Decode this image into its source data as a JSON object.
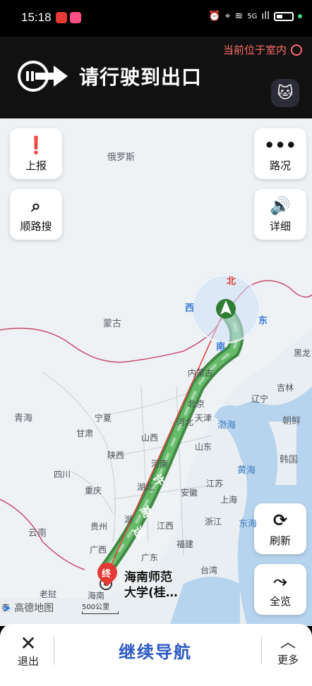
{
  "status_bar": {
    "time": "15:18",
    "network": "5G",
    "signal": "ıll"
  },
  "banner": {
    "indoor_label": "当前位于室内",
    "instruction": "请行驶到出口"
  },
  "map_buttons": {
    "report": "上报",
    "road_conditions": "路况",
    "search_along": "顺路搜",
    "details": "详细",
    "refresh": "刷新",
    "overview": "全览"
  },
  "compass": {
    "north": "北",
    "south": "南",
    "east": "东",
    "west": "西"
  },
  "map_labels": {
    "russia": "俄罗斯",
    "mongolia": "蒙古",
    "heilongjiang": "黑龙",
    "jilin": "吉林",
    "liaoning": "辽宁",
    "korea_north": "朝鲜",
    "korea_south": "韩国",
    "inner_mongolia": "内蒙古",
    "beijing": "北京",
    "tianjin": "天津",
    "bohai": "渤海",
    "hebei": "河北",
    "shanxi": "山西",
    "shandong": "山东",
    "yellow_sea": "黄海",
    "qinghai": "青海",
    "ningxia": "宁夏",
    "gansu": "甘肃",
    "shaanxi": "陕西",
    "henan": "河南",
    "sichuan": "四川",
    "hubei": "湖北",
    "anhui": "安徽",
    "jiangsu": "江苏",
    "shanghai": "上海",
    "chongqing": "重庆",
    "zhejiang": "浙江",
    "guizhou": "贵州",
    "hunan": "湖",
    "jiangxi": "江西",
    "east_china_sea": "东海",
    "yunnan": "云南",
    "guangxi": "广西",
    "guangdong": "广东",
    "fujian": "福建",
    "taiwan": "台湾",
    "laos": "老挝",
    "thailand": "泰",
    "hainan": "海南"
  },
  "route": {
    "highway_label_1": "许",
    "highway_label_2": "高",
    "highway_label_3": "速",
    "end_marker": "终",
    "destination_line1": "海南师范",
    "destination_line2": "大学(桂…"
  },
  "map_footer": {
    "brand": "高德地图",
    "scale": "500公里"
  },
  "bottom_bar": {
    "exit": "退出",
    "continue": "继续导航",
    "more": "更多"
  }
}
